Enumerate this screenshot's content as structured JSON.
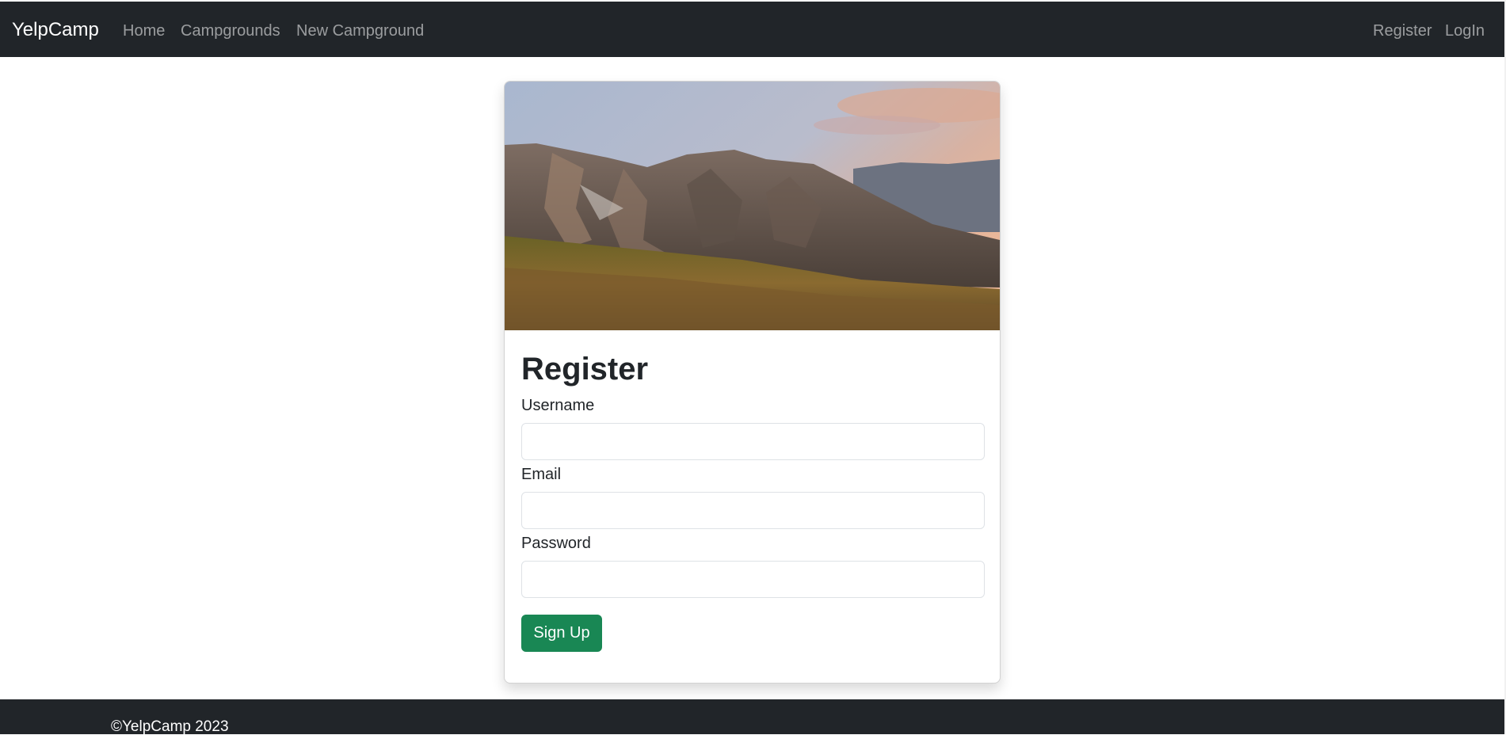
{
  "navbar": {
    "brand": "YelpCamp",
    "links": [
      {
        "label": "Home"
      },
      {
        "label": "Campgrounds"
      },
      {
        "label": "New Campground"
      }
    ],
    "right_links": [
      {
        "label": "Register"
      },
      {
        "label": "LogIn"
      }
    ]
  },
  "card": {
    "image_icon": "mountain-landscape-image",
    "title": "Register",
    "fields": [
      {
        "label": "Username",
        "value": "",
        "placeholder": ""
      },
      {
        "label": "Email",
        "value": "",
        "placeholder": ""
      },
      {
        "label": "Password",
        "value": "",
        "placeholder": ""
      }
    ],
    "submit_label": "Sign Up"
  },
  "footer": {
    "text": "©YelpCamp 2023"
  },
  "colors": {
    "navbar_bg": "#212529",
    "success": "#198754"
  }
}
